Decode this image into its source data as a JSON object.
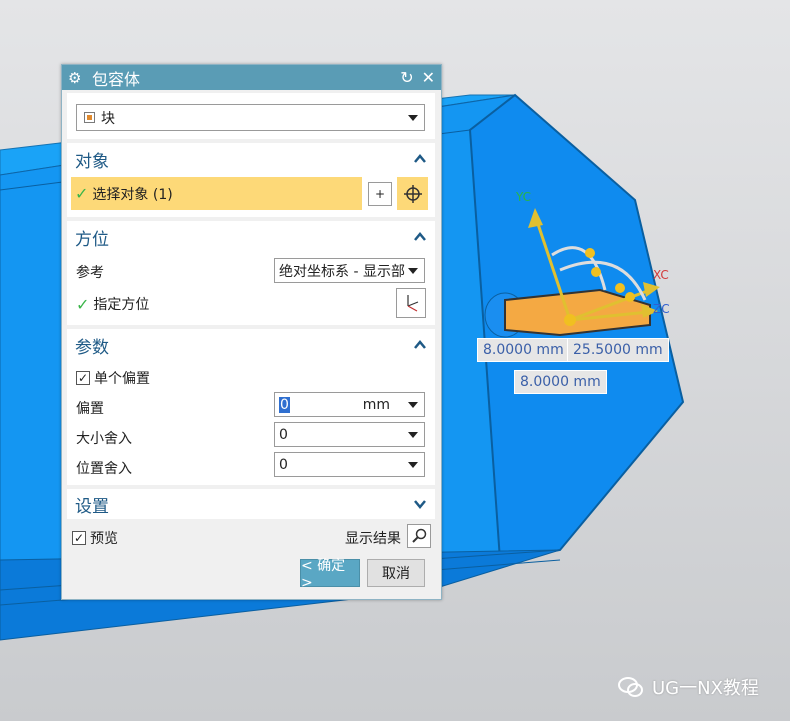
{
  "dialog": {
    "title": "包容体",
    "title_icon": "gear-icon",
    "reset_icon": "reset-icon",
    "close_icon": "close-icon",
    "type_value": "块",
    "sections": {
      "object": {
        "label": "对象",
        "select_label": "选择对象 (1)"
      },
      "orientation": {
        "label": "方位",
        "ref_label": "参考",
        "ref_value": "绝对坐标系 - 显示部",
        "specify_label": "指定方位"
      },
      "params": {
        "label": "参数",
        "single_offset_label": "单个偏置",
        "offset_label": "偏置",
        "offset_value": "0",
        "offset_unit": "mm",
        "size_round_label": "大小舍入",
        "size_round_value": "0",
        "pos_round_label": "位置舍入",
        "pos_round_value": "0"
      },
      "settings": {
        "label": "设置"
      }
    },
    "preview_label": "预览",
    "show_result_label": "显示结果",
    "ok_label": "< 确定 >",
    "cancel_label": "取消"
  },
  "viewport": {
    "dim_labels": [
      "8.0000 mm",
      "25.5000 mm",
      "8.0000 mm"
    ],
    "axis_labels": {
      "y": "YC",
      "x": "XC",
      "z": "ZC"
    }
  },
  "watermark": {
    "text": "UG一NX教程"
  },
  "colors": {
    "background": "#d7d9dc",
    "model": "#0a8cf0",
    "title_bar": "#5a9cb5",
    "accent": "#1f5a86",
    "highlight": "#fdd978"
  }
}
